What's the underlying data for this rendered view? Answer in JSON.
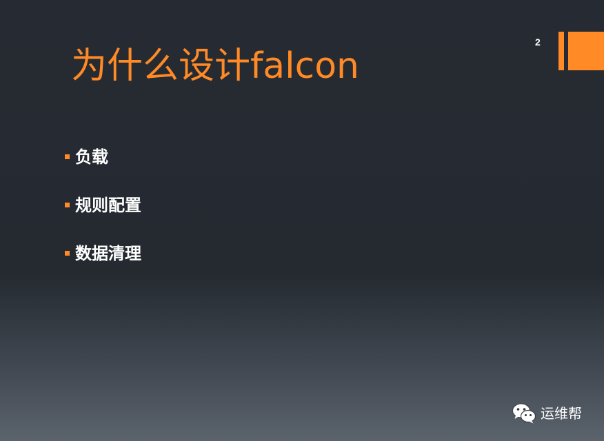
{
  "slide": {
    "title": "为什么设计falcon",
    "page_number": "2",
    "bullets": [
      {
        "text": "负载"
      },
      {
        "text": "规则配置"
      },
      {
        "text": "数据清理"
      }
    ],
    "watermark": {
      "icon": "wechat-icon",
      "text": "运维帮"
    },
    "colors": {
      "accent": "#ff8a26",
      "background_top": "#262b33",
      "background_bottom": "#5b636d",
      "text": "#ffffff"
    }
  }
}
